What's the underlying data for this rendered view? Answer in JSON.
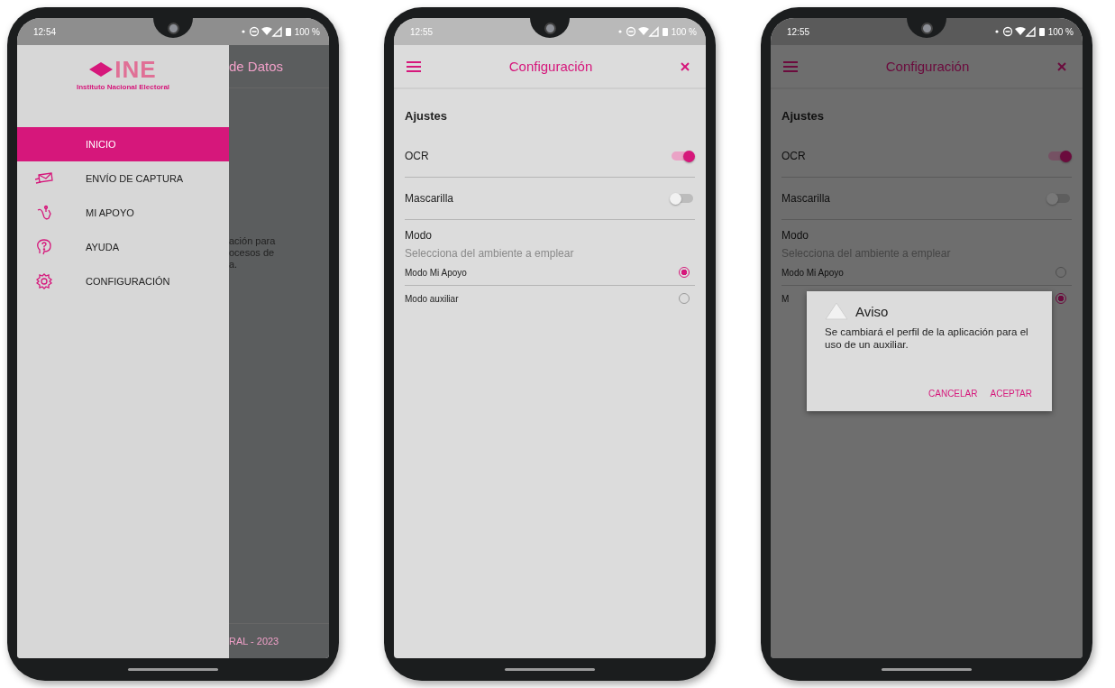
{
  "phones": [
    {
      "kind": "drawer",
      "status": {
        "time": "12:54",
        "battery": "100 %"
      },
      "backdrop": {
        "title": "de Datos",
        "text_lines": [
          "ación para",
          "ocesos de",
          "a."
        ],
        "footer": "RAL - 2023"
      },
      "drawer": {
        "logo": "INE",
        "logo_subtitle": "Instituto Nacional Electoral",
        "items": [
          {
            "label": "INICIO",
            "selected": true
          },
          {
            "label": "ENVÍO DE CAPTURA",
            "selected": false
          },
          {
            "label": "MI APOYO",
            "selected": false
          },
          {
            "label": "AYUDA",
            "selected": false
          },
          {
            "label": "CONFIGURACIÓN",
            "selected": false
          }
        ]
      }
    },
    {
      "kind": "settings",
      "status": {
        "time": "12:55",
        "battery": "100 %"
      },
      "header": {
        "title": "Configuración"
      },
      "section": "Ajustes",
      "toggles": [
        {
          "label": "OCR",
          "on": true
        },
        {
          "label": "Mascarilla",
          "on": false
        }
      ],
      "mode": {
        "title": "Modo",
        "subtitle": "Selecciona del ambiente a emplear",
        "options": [
          {
            "label": "Modo Mi Apoyo",
            "selected": true
          },
          {
            "label": "Modo auxiliar",
            "selected": false
          }
        ]
      }
    },
    {
      "kind": "settings",
      "status": {
        "time": "12:55",
        "battery": "100 %"
      },
      "header": {
        "title": "Configuración"
      },
      "section": "Ajustes",
      "toggles": [
        {
          "label": "OCR",
          "on": true
        },
        {
          "label": "Mascarilla",
          "on": false
        }
      ],
      "mode": {
        "title": "Modo",
        "subtitle": "Selecciona del ambiente a emplear",
        "options": [
          {
            "label": "Modo Mi Apoyo",
            "selected": false
          },
          {
            "label": "M",
            "selected": true
          }
        ]
      },
      "dialog": {
        "title": "Aviso",
        "message": "Se cambiará el perfil de la aplicación para el uso de un auxiliar.",
        "buttons": [
          "CANCELAR",
          "ACEPTAR"
        ]
      }
    }
  ]
}
